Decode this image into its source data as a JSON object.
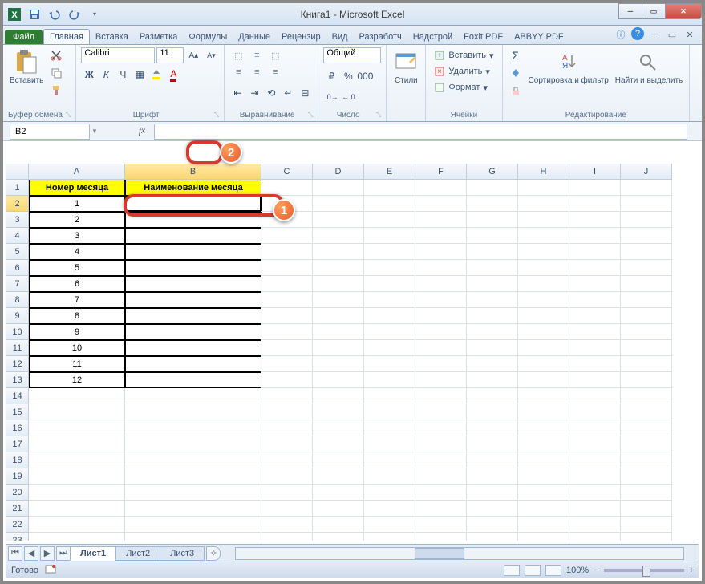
{
  "title": "Книга1  -  Microsoft Excel",
  "file_tab": "Файл",
  "tabs": [
    "Главная",
    "Вставка",
    "Разметка",
    "Формулы",
    "Данные",
    "Рецензир",
    "Вид",
    "Разработч",
    "Надстрой",
    "Foxit PDF",
    "ABBYY PDF"
  ],
  "active_tab": 0,
  "ribbon_groups": {
    "clipboard": {
      "label": "Буфер обмена",
      "paste": "Вставить"
    },
    "font": {
      "label": "Шрифт",
      "name": "Calibri",
      "size": "11"
    },
    "align": {
      "label": "Выравнивание"
    },
    "number": {
      "label": "Число",
      "format": "Общий"
    },
    "styles": {
      "label": "",
      "styles": "Стили"
    },
    "cells": {
      "label": "Ячейки",
      "insert": "Вставить",
      "delete": "Удалить",
      "format": "Формат"
    },
    "editing": {
      "label": "Редактирование",
      "sort": "Сортировка и фильтр",
      "find": "Найти и выделить"
    }
  },
  "namebox": "B2",
  "columns": [
    "A",
    "B",
    "C",
    "D",
    "E",
    "F",
    "G",
    "H",
    "I",
    "J"
  ],
  "headers": {
    "a": "Номер месяца",
    "b": "Наименование месяца"
  },
  "month_numbers": [
    "1",
    "2",
    "3",
    "4",
    "5",
    "6",
    "7",
    "8",
    "9",
    "10",
    "11",
    "12"
  ],
  "visible_rows": 24,
  "sheets": [
    "Лист1",
    "Лист2",
    "Лист3"
  ],
  "active_sheet": 0,
  "status": "Готово",
  "zoom": "100%",
  "callouts": {
    "c1": "1",
    "c2": "2"
  }
}
